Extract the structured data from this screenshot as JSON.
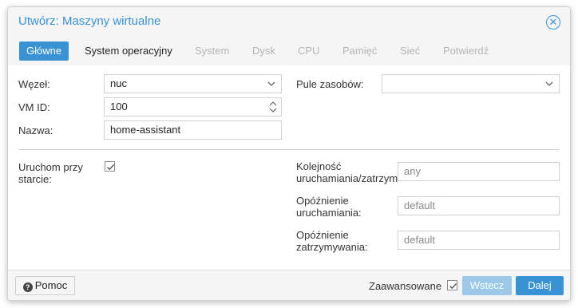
{
  "window": {
    "title": "Utwórz: Maszyny wirtualne"
  },
  "tabs": [
    {
      "label": "Główne",
      "state": "active"
    },
    {
      "label": "System operacyjny",
      "state": "enabled"
    },
    {
      "label": "System",
      "state": "disabled"
    },
    {
      "label": "Dysk",
      "state": "disabled"
    },
    {
      "label": "CPU",
      "state": "disabled"
    },
    {
      "label": "Pamięć",
      "state": "disabled"
    },
    {
      "label": "Sieć",
      "state": "disabled"
    },
    {
      "label": "Potwierdź",
      "state": "disabled"
    }
  ],
  "form": {
    "node_label": "Węzeł:",
    "node_value": "nuc",
    "vmid_label": "VM ID:",
    "vmid_value": "100",
    "name_label": "Nazwa:",
    "name_value": "home-assistant",
    "pool_label": "Pule zasobów:",
    "pool_value": "",
    "onboot_label": "Uruchom przy starcie:",
    "onboot_checked": true,
    "order_label": "Kolejność uruchamiania/zatrzym",
    "order_placeholder": "any",
    "startup_delay_label": "Opóźnienie uruchamiania:",
    "startup_delay_placeholder": "default",
    "shutdown_timeout_label": "Opóźnienie zatrzymywania:",
    "shutdown_timeout_placeholder": "default"
  },
  "footer": {
    "help_label": "Pomoc",
    "advanced_label": "Zaawansowane",
    "advanced_checked": true,
    "back_label": "Wstecz",
    "next_label": "Dalej"
  },
  "colors": {
    "accent": "#3892d4",
    "accent_disabled": "#9cc8ea",
    "tab_disabled_text": "#b5b5b5"
  }
}
